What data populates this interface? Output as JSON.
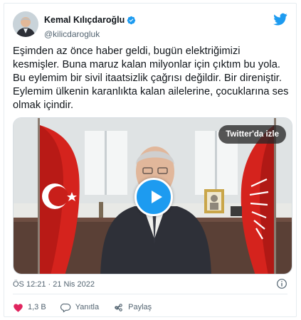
{
  "tweet": {
    "author": {
      "display_name": "Kemal Kılıçdaroğlu",
      "handle": "@kilicdarogluk",
      "verified": true
    },
    "text_lines": [
      "Eşimden az önce haber geldi, bugün elektriğimizi",
      "kesmişler. Buna maruz kalan milyonlar için çıktım bu yola.",
      "Bu eylemim bir sivil itaatsizlik çağrısı değildir. Bir direniştir.",
      "Eylemim ülkenin karanlıkta kalan ailelerine, çocuklarına ses",
      "olmak içindir."
    ],
    "media": {
      "watch_label": "Twitter'da izle"
    },
    "timestamp": "ÖS 12:21 · 21 Nis 2022",
    "actions": {
      "like_count": "1,3 B",
      "reply_label": "Yanıtla",
      "share_label": "Paylaş"
    }
  },
  "icons": {
    "brand": "twitter-bird-icon",
    "verified": "verified-badge-icon",
    "play": "play-icon",
    "info": "info-icon",
    "like": "heart-icon",
    "reply": "reply-icon",
    "share": "share-icon"
  },
  "colors": {
    "accent": "#1d9bf0",
    "like": "#e0245e",
    "text": "#0f1419",
    "muted": "#536471",
    "border": "#e6ecf0"
  }
}
